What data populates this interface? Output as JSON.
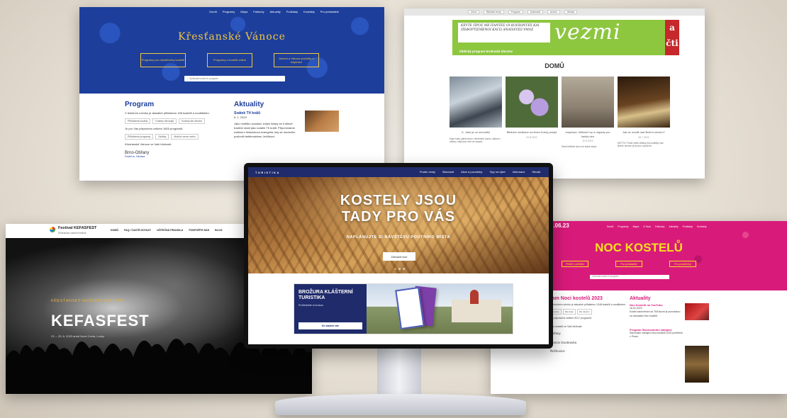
{
  "panel1": {
    "nav": [
      "Domů",
      "Programy",
      "Mapa",
      "Fakturky",
      "Aktuality",
      "Podklady",
      "Kontakty",
      "Pro pořadatele"
    ],
    "title": "Křesťanské Vánoce",
    "hero_buttons": [
      "Programy pro návštěvníky kostelů",
      "Programy z kostelů online",
      "Advent a Vánoce podněty a inspirace"
    ],
    "search_placeholder": "Vyhledat kostel či program",
    "program_heading": "Program",
    "program_text": "V letošním ročníku je aktuálně přihlášeno 168 kostelů a modliteben.",
    "program_tags": [
      "Přihlášené kostely",
      "Kostely dle krajů",
      "Kostely dle diecézí"
    ],
    "program_count": "Je pro Vás připraveno celkem 1800 programů.",
    "program_tags2": [
      "Přihlášené programy",
      "Zážitky",
      "Mobilní verze webu"
    ],
    "city_label": "Křesťanské Vánoce ve Vaší blízkosti:",
    "city": "Brno-Obřany",
    "city_sub": "Kostel sv. Václava",
    "news_heading": "Aktuality",
    "news_title": "Svátek Tří králů",
    "news_date": "6. 1. 2023",
    "news_text": "Jako motlitbu souslaví zdraví lidsky se ti ditavé tradiční staré jako svátek Tří králů. Připomínáme událost z Matoušova evangelia, kdy se mudrcům poklonili betlémskému Ježíškovi."
  },
  "panel2": {
    "topbar": [
      "Úvod",
      "Biblické texty",
      "Program",
      "Kalendář",
      "Archiv",
      "Hledat"
    ],
    "greek": "ΚΕΥΤΕ ΠΡΟΣ ΜΕ ΠΑΝΤΕΣ ΟΙ ΚΟΠΙΩΝΤΕΣ ΚΑΙ ΠΕΦΟΡΤΙΣΜΕΝΟΙ ΚΑΓΩ ΑΝΑΠΑΥΣΩ ΥΜΑΣ",
    "brand_word": "vezmi",
    "brand_red": "a čti",
    "banner_sub": "biblický program brněnské diecéze",
    "domu": "DOMŮ",
    "cards": [
      {
        "title": "K. Jaké je ve schodišti",
        "date": "",
        "text": "Když budu pátrat život v dřevěném duchu, žijeme v ohlasu, když jsou věci do smyslu."
      },
      {
        "title": "Biblická meditace na téma Dobrý pastýř",
        "date": "29.8.2022",
        "text": ""
      },
      {
        "title": "Inspirace, biblické hry a nápady pro každý den",
        "date": "22.8.2022",
        "text": "Staré biblické slovo se stává živým."
      },
      {
        "title": "Jak se modlit nad Božím slovem?",
        "date": "28.7.2022",
        "text": "MOTTO: Podle velké většiny lidí modlitby nad Božím slovem je jen pro vyvolené."
      }
    ]
  },
  "panel3": {
    "brand": "Festival KEFASFEST",
    "brand_sub": "Křesťanský hudební festival",
    "menu": [
      "DOMŮ",
      "FAQ / ČASTÉ DOTAZY",
      "UŽITEČNÁ PRAVIDLA",
      "PODPOŘTE NÁS",
      "BLOG"
    ],
    "cta": "KONTAKT",
    "kicker": "KŘESŤANSKÝ HUDEBNÍ FESTIVAL",
    "title": "KEFASFEST",
    "date": "23. – 25. 6. 2023 areál Nová Cesta, Louky"
  },
  "panel4": {
    "date_top": "2.06.23",
    "nav": [
      "Domů",
      "Programy",
      "Mapa",
      "O Noci",
      "Fakturky",
      "Aktuality",
      "Podklady",
      "Kontakty"
    ],
    "title": "NOC KOSTELŮ",
    "buttons": [
      "Příběh o přibližci",
      "Pro pořadatele",
      "Pro prosebníky"
    ],
    "search_placeholder": "Vyhledat kostel či program",
    "program_heading": "ram Noci kostelů 2023",
    "program_text": "V letošním ročníku je aktuálně přihlášeno 1348 kostelů a modliteben.",
    "program_tags": [
      "Kostely",
      "Dle krajů",
      "Dle diecézí"
    ],
    "program_count": "Je připraveno celkem 5017 programů.",
    "near": "Noc kostelů ve Vaší blízkosti:",
    "places": [
      "Obřany",
      "Vranov Doubravka",
      "Řečkovice"
    ],
    "news_heading": "Aktuality",
    "news1_title": "Noc Kostelů na YouTube",
    "news1_date": "16.02.2023",
    "news1_text": "Kostel záchvěmíní se TikTokové je pozvánkou na celostátní Noc kostelů.",
    "news2_title": "Program Slavnostního zahájení",
    "news2_text": "Slavnostní zahájení Noci kostelů 2023 proběhne v Praze."
  },
  "center": {
    "logo": "TURISTIKA",
    "menu": [
      "Poutní cesty",
      "Slavnosti",
      "Akce a pozvánky",
      "Tipy na výlet",
      "Informace",
      "Hledat"
    ],
    "headline": "KOSTELY JSOU TADY PRO VÁS",
    "subline": "NAPLÁNUJTE SI NÁVŠTĚVU POUTNÍHO MÍSTA",
    "hero_button": "Zobrazit více",
    "promo_title": "BROŽURA KLÁŠTERNÍ TURISTIKA",
    "promo_sub": "Prohlédněte si brožuru",
    "promo_button": "Ke stažení zde"
  }
}
